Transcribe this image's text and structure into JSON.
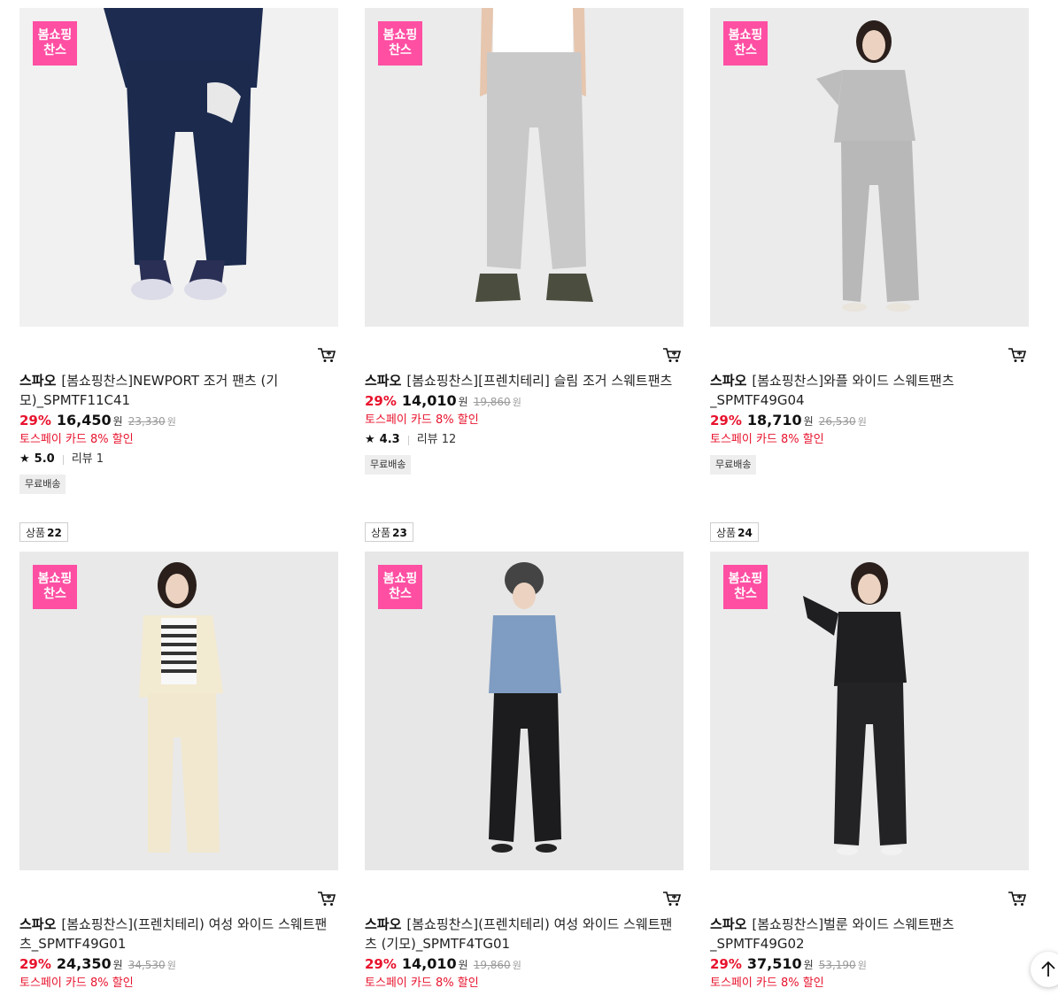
{
  "colors": {
    "accent_red": "#e8132d",
    "badge_pink": "#ff4fa3"
  },
  "badge_text": "봄쇼핑\n찬스",
  "products": [
    {
      "brand": "스파오",
      "name": "[봄쇼핑찬스]NEWPORT 조거 팬츠 (기모)_SPMTF11C41",
      "discount": "29%",
      "price": "16,450",
      "currency": "원",
      "original_price": "23,330",
      "promo": "토스페이 카드 8% 할인",
      "rating": "5.0",
      "review": "리뷰 1",
      "tag": "무료배송",
      "image_icon": "navy-jogger-photo"
    },
    {
      "brand": "스파오",
      "name": "[봄쇼핑찬스][프렌치테리] 슬림 조거 스웨트팬츠",
      "discount": "29%",
      "price": "14,010",
      "currency": "원",
      "original_price": "19,860",
      "promo": "토스페이 카드 8% 할인",
      "rating": "4.3",
      "review": "리뷰 12",
      "tag": "무료배송",
      "image_icon": "gray-jogger-photo"
    },
    {
      "brand": "스파오",
      "name": "[봄쇼핑찬스]와플 와이드 스웨트팬츠 _SPMTF49G04",
      "discount": "29%",
      "price": "18,710",
      "currency": "원",
      "original_price": "26,530",
      "promo": "토스페이 카드 8% 할인",
      "tag": "무료배송",
      "image_icon": "gray-wide-pants-photo"
    },
    {
      "rank_label": "상품",
      "rank_num": "22",
      "brand": "스파오",
      "name": "[봄쇼핑찬스](프렌치테리) 여성 와이드 스웨트팬츠_SPMTF49G01",
      "discount": "29%",
      "price": "24,350",
      "currency": "원",
      "original_price": "34,530",
      "promo": "토스페이 카드 8% 할인",
      "image_icon": "cream-wide-pants-photo"
    },
    {
      "rank_label": "상품",
      "rank_num": "23",
      "brand": "스파오",
      "name": "[봄쇼핑찬스](프렌치테리) 여성 와이드 스웨트팬츠 (기모)_SPMTF4TG01",
      "discount": "29%",
      "price": "14,010",
      "currency": "원",
      "original_price": "19,860",
      "promo": "토스페이 카드 8% 할인",
      "image_icon": "black-wide-pants-blue-cardigan-photo"
    },
    {
      "rank_label": "상품",
      "rank_num": "24",
      "brand": "스파오",
      "name": "[봄쇼핑찬스]벌룬 와이드 스웨트팬츠 _SPMTF49G02",
      "discount": "29%",
      "price": "37,510",
      "currency": "원",
      "original_price": "53,190",
      "promo": "토스페이 카드 8% 할인",
      "image_icon": "black-balloon-pants-photo"
    }
  ],
  "scroll_top_icon": "arrow-up-icon"
}
